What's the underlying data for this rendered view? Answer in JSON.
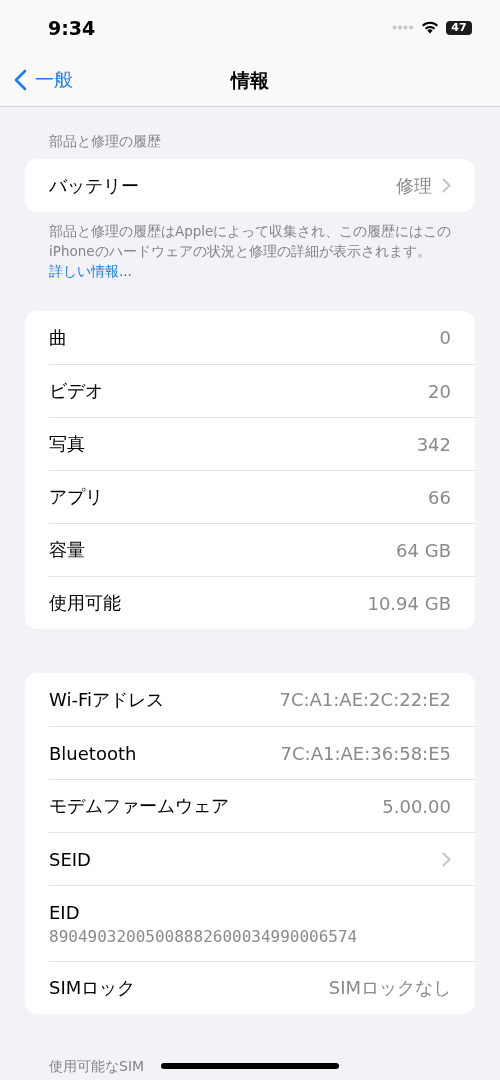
{
  "status_bar": {
    "time": "9:34",
    "battery": "47"
  },
  "nav": {
    "back": "一般",
    "title": "情報"
  },
  "repair_section": {
    "header": "部品と修理の履歴",
    "rows": [
      {
        "kind": "link",
        "label": "バッテリー",
        "value": "修理"
      }
    ],
    "footer": {
      "text": "部品と修理の履歴はAppleによって収集され、この履歴にはこのiPhoneのハードウェアの状況と修理の詳細が表示されます。",
      "link": "詳しい情報..."
    }
  },
  "media_section": {
    "rows": [
      {
        "kind": "value",
        "label": "曲",
        "value": "0"
      },
      {
        "kind": "value",
        "label": "ビデオ",
        "value": "20"
      },
      {
        "kind": "value",
        "label": "写真",
        "value": "342"
      },
      {
        "kind": "value",
        "label": "アプリ",
        "value": "66"
      },
      {
        "kind": "value",
        "label": "容量",
        "value": "64 GB"
      },
      {
        "kind": "value",
        "label": "使用可能",
        "value": "10.94 GB"
      }
    ]
  },
  "network_section": {
    "rows": [
      {
        "kind": "value",
        "label": "Wi-Fiアドレス",
        "value": "7C:A1:AE:2C:22:E2"
      },
      {
        "kind": "value",
        "label": "Bluetooth",
        "value": "7C:A1:AE:36:58:E5"
      },
      {
        "kind": "value",
        "label": "モデムファームウェア",
        "value": "5.00.00"
      },
      {
        "kind": "chevron",
        "label": "SEID"
      },
      {
        "kind": "stacked",
        "label": "EID",
        "value": "89049032005008882600034990006574"
      },
      {
        "kind": "value",
        "label": "SIMロック",
        "value": "SIMロックなし"
      }
    ]
  },
  "sim_section": {
    "header": "使用可能なSIM"
  }
}
